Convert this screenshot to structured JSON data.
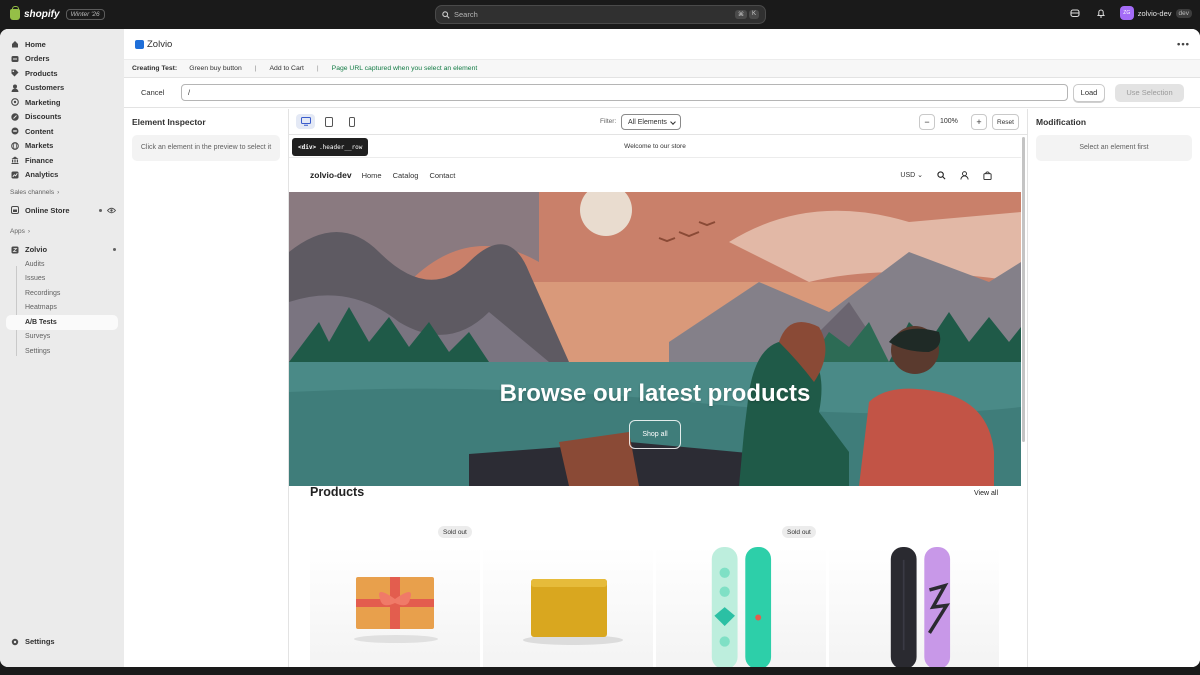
{
  "topbar": {
    "brand": "shopify",
    "edition": "Winter '26",
    "search_placeholder": "Search",
    "shortcut_keys": [
      "⌘",
      "K"
    ],
    "avatar_initials": "ZG",
    "store_name": "zolvio-dev",
    "env_badge": "dev"
  },
  "sidebar": {
    "items": [
      {
        "label": "Home",
        "icon": "home-icon"
      },
      {
        "label": "Orders",
        "icon": "orders-icon"
      },
      {
        "label": "Products",
        "icon": "tag-icon"
      },
      {
        "label": "Customers",
        "icon": "person-icon"
      },
      {
        "label": "Marketing",
        "icon": "target-icon"
      },
      {
        "label": "Discounts",
        "icon": "discount-icon"
      },
      {
        "label": "Content",
        "icon": "content-icon"
      },
      {
        "label": "Markets",
        "icon": "globe-icon"
      },
      {
        "label": "Finance",
        "icon": "bank-icon"
      },
      {
        "label": "Analytics",
        "icon": "chart-icon"
      }
    ],
    "sales_channels_label": "Sales channels",
    "online_store_label": "Online Store",
    "apps_label": "Apps",
    "app_name": "Zolvio",
    "app_subitems": [
      "Audits",
      "Issues",
      "Recordings",
      "Heatmaps",
      "A/B Tests",
      "Surveys",
      "Settings"
    ],
    "active_subitem": "A/B Tests",
    "settings_label": "Settings"
  },
  "app": {
    "title": "Zolvio",
    "more_label": "•••"
  },
  "test_bar": {
    "creating_label": "Creating Test:",
    "test_name": "Green buy button",
    "step": "Add to Cart",
    "hint": "Page URL captured when you select an element",
    "separator": "|"
  },
  "url_row": {
    "cancel_label": "Cancel",
    "url_value": "/",
    "load_label": "Load",
    "use_selection_label": "Use Selection"
  },
  "inspector": {
    "title": "Element Inspector",
    "empty_text": "Click an element in the preview to select it"
  },
  "modification": {
    "title": "Modification",
    "empty_text": "Select an element first"
  },
  "preview_toolbar": {
    "filter_label": "Filter:",
    "filter_value": "All Elements",
    "zoom_out": "−",
    "zoom_level": "100%",
    "zoom_in": "+",
    "reset_label": "Reset",
    "active_device": "desktop"
  },
  "tooltip": {
    "tag": "<div>",
    "selector": ".header__row"
  },
  "store": {
    "announcement": "Welcome to our store",
    "name": "zolvio-dev",
    "nav": [
      "Home",
      "Catalog",
      "Contact"
    ],
    "currency": "USD",
    "hero_title": "Browse our latest products",
    "hero_button": "Shop all",
    "products_heading": "Products",
    "view_all": "View all",
    "products": [
      {
        "image": "gift-card",
        "badge": "Sold out"
      },
      {
        "image": "wax-bar",
        "badge": ""
      },
      {
        "image": "snowboard-teal",
        "badge": "Sold out"
      },
      {
        "image": "snowboard-purple",
        "badge": ""
      }
    ]
  },
  "colors": {
    "topbar": "#1a1a1a",
    "sidebar": "#ebebeb",
    "accent_green": "#127b44",
    "avatar": "#a46cf7",
    "app_logo": "#1f6fd9"
  }
}
